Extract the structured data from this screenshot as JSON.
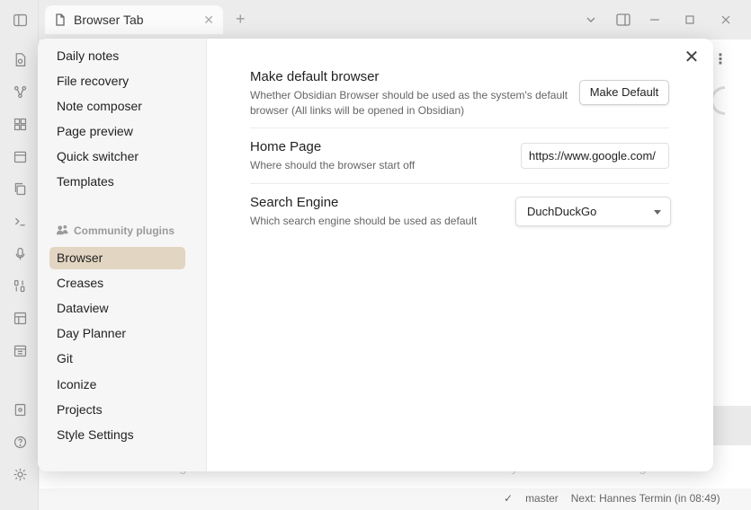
{
  "tab": {
    "title": "Browser Tab",
    "close": "✕"
  },
  "modal": {
    "close": "✕"
  },
  "sidebar": {
    "core_items": [
      {
        "label": "Daily notes"
      },
      {
        "label": "File recovery"
      },
      {
        "label": "Note composer"
      },
      {
        "label": "Page preview"
      },
      {
        "label": "Quick switcher"
      },
      {
        "label": "Templates"
      }
    ],
    "community_heading": "Community plugins",
    "community_items": [
      {
        "label": "Browser",
        "active": true
      },
      {
        "label": "Creases"
      },
      {
        "label": "Dataview"
      },
      {
        "label": "Day Planner"
      },
      {
        "label": "Git"
      },
      {
        "label": "Iconize"
      },
      {
        "label": "Projects"
      },
      {
        "label": "Style Settings"
      }
    ]
  },
  "settings": {
    "default_browser": {
      "name": "Make default browser",
      "desc": "Whether Obsidian Browser should be used as the system's default browser (All links will be opened in Obsidian)",
      "button": "Make Default"
    },
    "home_page": {
      "name": "Home Page",
      "desc": "Where should the browser start off",
      "value": "https://www.google.com/"
    },
    "search_engine": {
      "name": "Search Engine",
      "desc": "Which search engine should be used as default",
      "selected": "DuchDuckGo"
    }
  },
  "statusbar": {
    "branch": "master",
    "next": "Next: Hannes Termin (in 08:49)"
  },
  "background_footer": [
    "Advertising",
    "Business",
    "How Search works",
    "Privacy",
    "Terms",
    "Settings"
  ],
  "colors": {
    "active_item": "#e2d6c2",
    "sidebar_bg": "#f6f6f6"
  }
}
